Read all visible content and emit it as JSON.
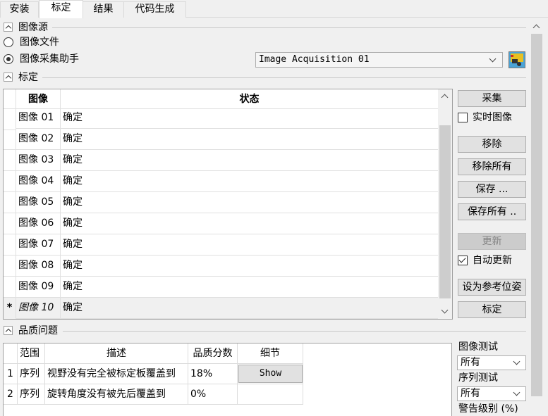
{
  "tabs": [
    "安装",
    "标定",
    "结果",
    "代码生成"
  ],
  "image_source": {
    "title": "图像源",
    "option_file": "图像文件",
    "option_assistant": "图像采集助手",
    "assistant_value": "Image Acquisition 01"
  },
  "calibration": {
    "title": "标定",
    "columns": [
      "图像",
      "状态"
    ],
    "rows": [
      {
        "name": "图像 01",
        "status": "确定"
      },
      {
        "name": "图像 02",
        "status": "确定"
      },
      {
        "name": "图像 03",
        "status": "确定"
      },
      {
        "name": "图像 04",
        "status": "确定"
      },
      {
        "name": "图像 05",
        "status": "确定"
      },
      {
        "name": "图像 06",
        "status": "确定"
      },
      {
        "name": "图像 07",
        "status": "确定"
      },
      {
        "name": "图像 08",
        "status": "确定"
      },
      {
        "name": "图像 09",
        "status": "确定"
      },
      {
        "name": "图像 10",
        "status": "确定",
        "marker": "*"
      }
    ]
  },
  "buttons": {
    "acquire": "采集",
    "live_image": "实时图像",
    "remove": "移除",
    "remove_all": "移除所有",
    "save": "保存 ...",
    "save_all": "保存所有 ..",
    "update": "更新",
    "auto_update": "自动更新",
    "set_reference": "设为参考位姿",
    "calibrate": "标定"
  },
  "quality": {
    "title": "品质问题",
    "columns": [
      "范围",
      "描述",
      "品质分数",
      "细节"
    ],
    "rows": [
      {
        "idx": "1",
        "scope": "序列",
        "desc": "视野没有完全被标定板覆盖到",
        "score": "18%",
        "detail": "Show"
      },
      {
        "idx": "2",
        "scope": "序列",
        "desc": "旋转角度没有被先后覆盖到",
        "score": "0%",
        "detail": ""
      }
    ],
    "image_test_label": "图像测试",
    "image_test_value": "所有",
    "sequence_test_label": "序列测试",
    "sequence_test_value": "所有",
    "warning_level_label": "警告级别 (%)"
  }
}
